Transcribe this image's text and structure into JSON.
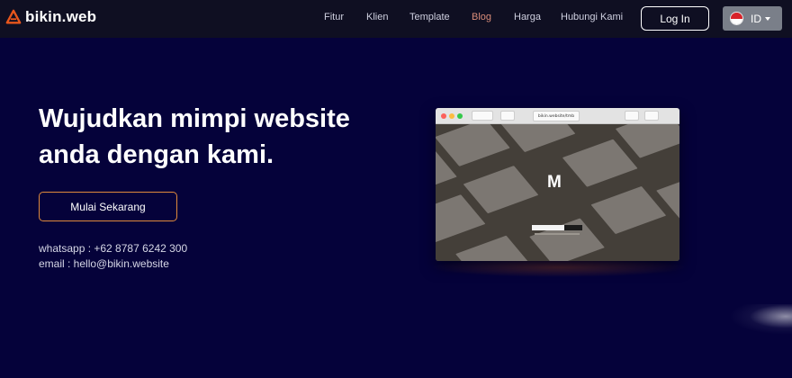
{
  "brand": {
    "name": "bikin.web",
    "accent": "#e8561c"
  },
  "nav": {
    "items": [
      {
        "label": "Fitur",
        "active": false
      },
      {
        "label": "Klien",
        "active": false
      },
      {
        "label": "Template",
        "active": false
      },
      {
        "label": "Blog",
        "active": true
      },
      {
        "label": "Harga",
        "active": false
      },
      {
        "label": "Hubungi Kami",
        "active": false
      }
    ],
    "login_label": "Log In",
    "language": {
      "code": "ID",
      "flag": "indonesia-flag-icon"
    }
  },
  "hero": {
    "headline_line1": "Wujudkan mimpi website",
    "headline_line2": "anda dengan kami.",
    "cta_label": "Mulai Sekarang",
    "whatsapp": "whatsapp : +62 8787 6242 300",
    "email": "email : hello@bikin.website"
  },
  "mockup": {
    "url": "bikin.website/tmb",
    "site_logo": "M"
  },
  "colors": {
    "background": "#05023a",
    "navbar": "#0f0f22",
    "cta_border": "#e08a3c",
    "active_link": "#d98c79"
  }
}
